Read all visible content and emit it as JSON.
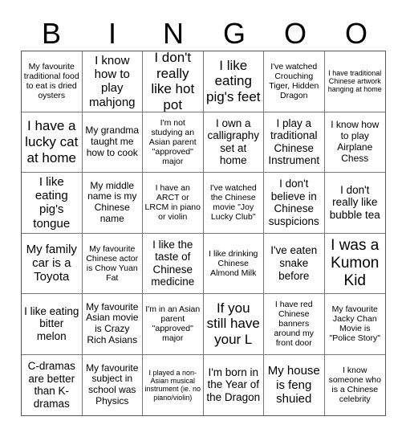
{
  "title_letters": [
    "B",
    "I",
    "N",
    "G",
    "O",
    "O"
  ],
  "cells": [
    {
      "text": "My favourite traditional food to eat is dried oysters",
      "size": "s2"
    },
    {
      "text": "I know how to play mahjong",
      "size": "s5"
    },
    {
      "text": "I don't really like hot pot",
      "size": "s6"
    },
    {
      "text": "I like eating pig's feet",
      "size": "s6"
    },
    {
      "text": "I've watched Crouching Tiger, Hidden Dragon",
      "size": "s2"
    },
    {
      "text": "I have traditional Chinese artwork hanging at home",
      "size": "s1"
    },
    {
      "text": "I have a lucky cat at home",
      "size": "s6"
    },
    {
      "text": "My grandma taught me how to cook",
      "size": "s3"
    },
    {
      "text": "I'm not studying an Asian parent \"approved\" major",
      "size": "s2"
    },
    {
      "text": "I own a calligraphy set at home",
      "size": "s4"
    },
    {
      "text": "I play a traditional Chinese Instrument",
      "size": "s4"
    },
    {
      "text": "I know how to play Airplane Chess",
      "size": "s3"
    },
    {
      "text": "I like eating pig's tongue",
      "size": "s5"
    },
    {
      "text": "My middle name is my Chinese name",
      "size": "s3"
    },
    {
      "text": "I have an ARCT or LRCM in piano or violin",
      "size": "s2"
    },
    {
      "text": "I've watched the Chinese movie \"Joy Lucky Club\"",
      "size": "s2"
    },
    {
      "text": "I don't believe in Chinese suspicions",
      "size": "s4"
    },
    {
      "text": "I don't really like bubble tea",
      "size": "s4"
    },
    {
      "text": "My family car is a Toyota",
      "size": "s5"
    },
    {
      "text": "My favourite Chinese actor is Chow Yuan Fat",
      "size": "s2"
    },
    {
      "text": "I like the taste of Chinese medicine",
      "size": "s4"
    },
    {
      "text": "I like drinking Chinese Almond Milk",
      "size": "s2"
    },
    {
      "text": "I've eaten snake before",
      "size": "s4"
    },
    {
      "text": "I was a Kumon Kid",
      "size": "s7"
    },
    {
      "text": "I like eating bitter melon",
      "size": "s4"
    },
    {
      "text": "My favourite Asian movie is Crazy Rich Asians",
      "size": "s3"
    },
    {
      "text": "I'm in an Asian parent \"approved\" major",
      "size": "s2"
    },
    {
      "text": "If you still have your L",
      "size": "s6"
    },
    {
      "text": "I have red Chinese banners around my front door",
      "size": "s2"
    },
    {
      "text": "My favourite Jacky Chan Movie is \"Police Story\"",
      "size": "s2"
    },
    {
      "text": "C-dramas are better than K-dramas",
      "size": "s4"
    },
    {
      "text": "My favourite subject in school was Physics",
      "size": "s3"
    },
    {
      "text": "I played a non-Asian musical instrument (ie. no piano/violin)",
      "size": "s1"
    },
    {
      "text": "I'm born in the Year of the Dragon",
      "size": "s4"
    },
    {
      "text": "My house is feng shuied",
      "size": "s5"
    },
    {
      "text": "I know someone who is a Chinese celebrity",
      "size": "s2"
    }
  ]
}
